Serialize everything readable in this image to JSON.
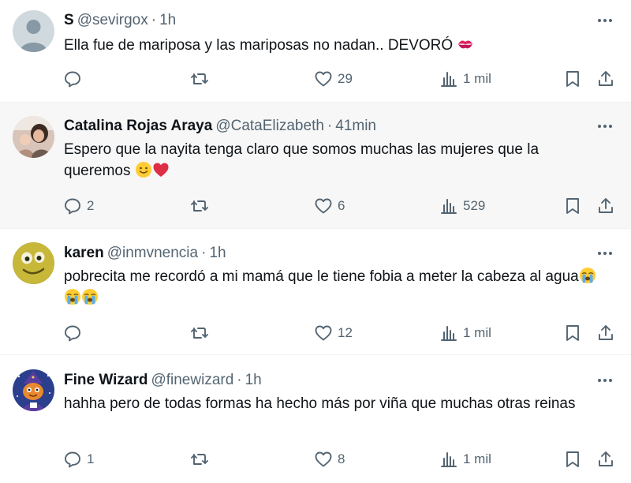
{
  "colors": {
    "text": "#0f1419",
    "secondary": "#536471",
    "divider": "#eff3f4",
    "highlight_bg": "#f7f7f7",
    "heart_red": "#e0245e"
  },
  "tweets": [
    {
      "name": "S",
      "handle": "@sevirgox",
      "separator": "·",
      "time": "1h",
      "text": "Ella fue de mariposa y las mariposas no nadan.. DEVORÓ",
      "emoji_after": [
        "kiss-mark"
      ],
      "replies": "",
      "retweets": "",
      "likes": "29",
      "views": "1 mil",
      "avatar": "default-avatar"
    },
    {
      "name": "Catalina Rojas Araya",
      "handle": "@CataElizabeth",
      "separator": "·",
      "time": "41min",
      "text": "Espero que la  nayita tenga claro que somos  muchas las mujeres que la queremos",
      "emoji_after": [
        "slightly-smiling-face",
        "red-heart"
      ],
      "replies": "2",
      "retweets": "",
      "likes": "6",
      "views": "529",
      "avatar": "photo-avatar"
    },
    {
      "name": "karen",
      "handle": "@inmvnencia",
      "separator": "·",
      "time": "1h",
      "text": "pobrecita me recordó a mi mamá que le tiene fobia a meter la cabeza al agua",
      "emoji_after": [
        "loudly-crying-face",
        "loudly-crying-face",
        "loudly-crying-face"
      ],
      "replies": "",
      "retweets": "",
      "likes": "12",
      "views": "1 mil",
      "avatar": "smiley-avatar"
    },
    {
      "name": "Fine Wizard",
      "handle": "@finewizard",
      "separator": "·",
      "time": "1h",
      "text": "hahha pero de todas formas ha hecho más por viña que muchas otras reinas",
      "emoji_after": [],
      "replies": "1",
      "retweets": "",
      "likes": "8",
      "views": "1 mil",
      "avatar": "wizard-avatar"
    }
  ]
}
